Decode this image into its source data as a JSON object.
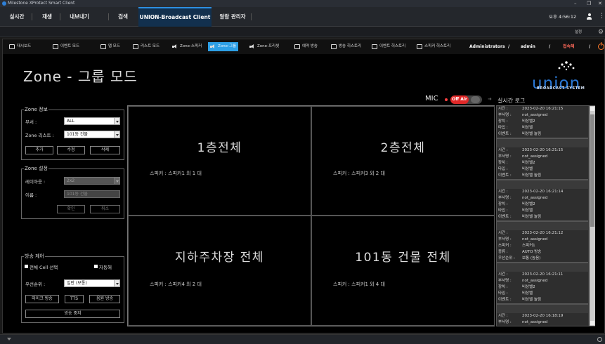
{
  "window": {
    "title": "Milestone XProtect Smart Client"
  },
  "main_tabs": [
    "실시간",
    "재생",
    "내보내기",
    "검색",
    "UNION-Broadcast Client",
    "알람 관리자"
  ],
  "clock": "오후 4:56:12",
  "settings_label": "설정",
  "app_nav": {
    "items": [
      "대시보드",
      "이벤트 모드",
      "맵 모드",
      "리스트 모드",
      "Zone-스피커",
      "Zone-그룹",
      "Zone-프리셋",
      "예약 방송",
      "방송 히스토리",
      "이벤트 히스토리",
      "스피커 히스토리"
    ],
    "active_index": 5,
    "user_prefix": "Administrators",
    "separator": "/",
    "user": "admin",
    "logout": "접속해"
  },
  "page_title": "Zone - 그룹 모드",
  "mic": {
    "label": "MIC",
    "toggle_text": "Off Air"
  },
  "logo": {
    "text": "union",
    "subtitle": "BROADCAST SYSTEM",
    "brand_color": "#2a78d6"
  },
  "zone_info": {
    "title": "Zone 정보",
    "dept_label": "부서 :",
    "dept_value": "ALL",
    "list_label": "Zone 리스트 :",
    "list_value": "101동 건물",
    "buttons": [
      "추가",
      "수정",
      "삭제"
    ]
  },
  "zone_settings": {
    "title": "Zone 설정",
    "layout_label": "레이아웃 :",
    "layout_value": "2x2",
    "name_label": "이름 :",
    "name_value": "101동 건물",
    "buttons": [
      "확인",
      "취소"
    ]
  },
  "broadcast_control": {
    "title": "방송 제어",
    "select_all": "전체 Cell 선택",
    "auto_release": "자동해",
    "priority_label": "우선순위 :",
    "priority_value": "일반 (보통)",
    "buttons": [
      "마이크 방송",
      "TTS",
      "음원 방송"
    ],
    "stop": "방송 중지"
  },
  "grid": [
    {
      "title": "1층전체",
      "speakers": "스피커 : 스피커1 외 1 대"
    },
    {
      "title": "2층전체",
      "speakers": "스피커 : 스피커3 외 2 대"
    },
    {
      "title": "지하주차장 전체",
      "speakers": "스피커 : 스피커4 외 2 대"
    },
    {
      "title": "101동 건물 전체",
      "speakers": "스피커 : 스피커1 외 4 대"
    }
  ],
  "log": {
    "title": "실시간 로그",
    "entries": [
      {
        "rows": [
          [
            "시간 :",
            "2023-02-20 16:21:15"
          ],
          [
            "부서명 :",
            "not_assigned"
          ],
          [
            "장치 :",
            "비상벨2"
          ],
          [
            "타입 :",
            "비상벨"
          ],
          [
            "이벤트 :",
            "비상벨 눌림"
          ]
        ]
      },
      {
        "rows": [
          [
            "시간 :",
            "2023-02-20 16:21:15"
          ],
          [
            "부서명 :",
            "not_assigned"
          ],
          [
            "장치 :",
            "비상벨2"
          ],
          [
            "타입 :",
            "비상벨"
          ],
          [
            "이벤트 :",
            "비상벨 눌림"
          ]
        ]
      },
      {
        "rows": [
          [
            "시간 :",
            "2023-02-20 16:21:14"
          ],
          [
            "부서명 :",
            "not_assigned"
          ],
          [
            "장치 :",
            "비상벨2"
          ],
          [
            "타입 :",
            "비상벨"
          ],
          [
            "이벤트 :",
            "비상벨 눌림"
          ]
        ]
      },
      {
        "rows": [
          [
            "시간 :",
            "2023-02-20 16:21:12"
          ],
          [
            "부서명 :",
            "not_assigned"
          ],
          [
            "스피커 :",
            "스피커1"
          ],
          [
            "종류 :",
            "AUTO 방송"
          ],
          [
            "우선순위 :",
            "보통 (높음)"
          ]
        ]
      },
      {
        "rows": [
          [
            "시간 :",
            "2023-02-20 16:21:11"
          ],
          [
            "부서명 :",
            "not_assigned"
          ],
          [
            "장치 :",
            "비상벨2"
          ],
          [
            "타입 :",
            "비상벨"
          ],
          [
            "이벤트 :",
            "비상벨 눌림"
          ]
        ]
      },
      {
        "rows": [
          [
            "시간 :",
            "2023-02-20 16:18:19"
          ],
          [
            "부서명 :",
            "not_assigned"
          ]
        ]
      }
    ]
  }
}
